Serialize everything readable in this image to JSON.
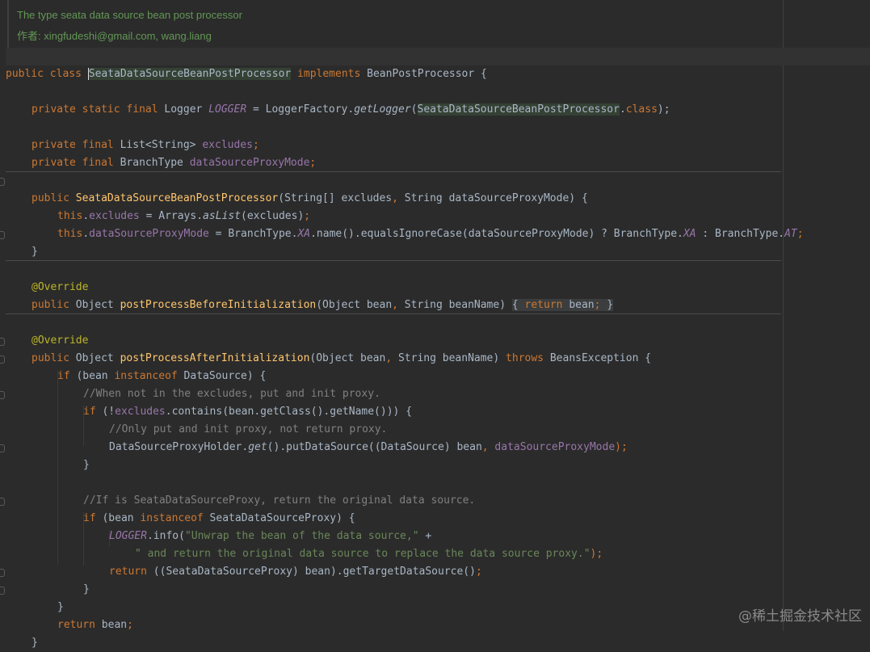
{
  "doc_comment": {
    "line1": "The type seata data source bean post processor",
    "line2": "作者: xingfudeshi@gmail.com, wang.liang"
  },
  "code": {
    "l1_public": "public",
    "l1_class": "class",
    "l1_name": "SeataDataSourceBeanPostProcessor",
    "l1_implements": "implements",
    "l1_iface": "BeanPostProcessor",
    "l1_brace": "{",
    "l2_private": "private",
    "l2_static": "static",
    "l2_final": "final",
    "l2_type": "Logger",
    "l2_field": "LOGGER",
    "l2_eq": "=",
    "l2_factory": "LoggerFactory.",
    "l2_method": "getLogger",
    "l2_paren_open": "(",
    "l2_arg": "SeataDataSourceBeanPostProcessor",
    "l2_dot": ".",
    "l2_classkw": "class",
    "l2_end": ");",
    "l3_private": "private",
    "l3_final": "final",
    "l3_type": "List<String>",
    "l3_field": "excludes",
    "l3_semi": ";",
    "l4_private": "private",
    "l4_final": "final",
    "l4_type": "BranchType",
    "l4_field": "dataSourceProxyMode",
    "l4_semi": ";",
    "ctor_public": "public",
    "ctor_name": "SeataDataSourceBeanPostProcessor",
    "ctor_params_a": "(String[] excludes",
    "ctor_comma": ",",
    "ctor_params_b": " String dataSourceProxyMode) ",
    "ctor_brace": "{",
    "c1_this": "this",
    "c1_dot": ".",
    "c1_field": "excludes",
    "c1_eq": " = Arrays.",
    "c1_method": "asList",
    "c1_args": "(excludes)",
    "c1_semi": ";",
    "c2_this": "this",
    "c2_dot": ".",
    "c2_field": "dataSourceProxyMode",
    "c2_mid": " = BranchType.",
    "c2_xa": "XA",
    "c2_rest": ".name().equalsIgnoreCase(dataSourceProxyMode) ? BranchType.",
    "c2_xa2": "XA",
    "c2_colon": " : BranchType.",
    "c2_at": "AT",
    "c2_semi": ";",
    "ctor_close": "}",
    "ann1": "@Override",
    "before_public": "public",
    "before_type": " Object ",
    "before_name": "postProcessBeforeInitialization",
    "before_params_a": "(Object bean",
    "before_comma": ",",
    "before_params_b": " String beanName) ",
    "before_body_open": "{ ",
    "before_return": "return",
    "before_bean": " bean",
    "before_semi": ";",
    "before_close": " }",
    "ann2": "@Override",
    "after_public": "public",
    "after_type": " Object ",
    "after_name": "postProcessAfterInitialization",
    "after_params_a": "(Object bean",
    "after_comma": ",",
    "after_params_b": " String beanName) ",
    "after_throws": "throws",
    "after_exc": " BeansException ",
    "after_brace": "{",
    "if1_if": "if",
    "if1_a": " (bean ",
    "if1_instanceof": "instanceof",
    "if1_b": " DataSource) ",
    "if1_brace": "{",
    "cmt1": "//When not in the excludes, put and init proxy.",
    "if2_if": "if",
    "if2_a": " (!",
    "if2_field": "excludes",
    "if2_b": ".contains(bean.getClass().getName())) ",
    "if2_brace": "{",
    "cmt2": "//Only put and init proxy, not return proxy.",
    "put_a": "DataSourceProxyHolder.",
    "put_get": "get",
    "put_b": "().putDataSource((DataSource) bean",
    "put_comma": ",",
    "put_field": " dataSourceProxyMode",
    "put_end": ");",
    "if2_close": "}",
    "cmt3": "//If is SeataDataSourceProxy, return the original data source.",
    "if3_if": "if",
    "if3_a": " (bean ",
    "if3_instanceof": "instanceof",
    "if3_b": " SeataDataSourceProxy) ",
    "if3_brace": "{",
    "log_field": "LOGGER",
    "log_a": ".info(",
    "log_str1": "\"Unwrap the bean of the data source,\"",
    "log_plus": " +",
    "log_str2": "\" and return the original data source to replace the data source proxy.\"",
    "log_end": ");",
    "ret_return": "return",
    "ret_a": " ((SeataDataSourceProxy) bean).getTargetDataSource()",
    "ret_semi": ";",
    "if3_close": "}",
    "if1_close": "}",
    "final_return": "return",
    "final_bean": " bean",
    "final_semi": ";",
    "method_close": "}"
  },
  "watermark": "@稀土掘金技术社区",
  "colors": {
    "background": "#2b2b2b",
    "keyword": "#cc7832",
    "method": "#ffc66d",
    "field": "#9876aa",
    "annotation": "#bbb529",
    "string": "#6a8759",
    "comment": "#808080",
    "doc": "#629755",
    "text": "#a9b7c6"
  }
}
